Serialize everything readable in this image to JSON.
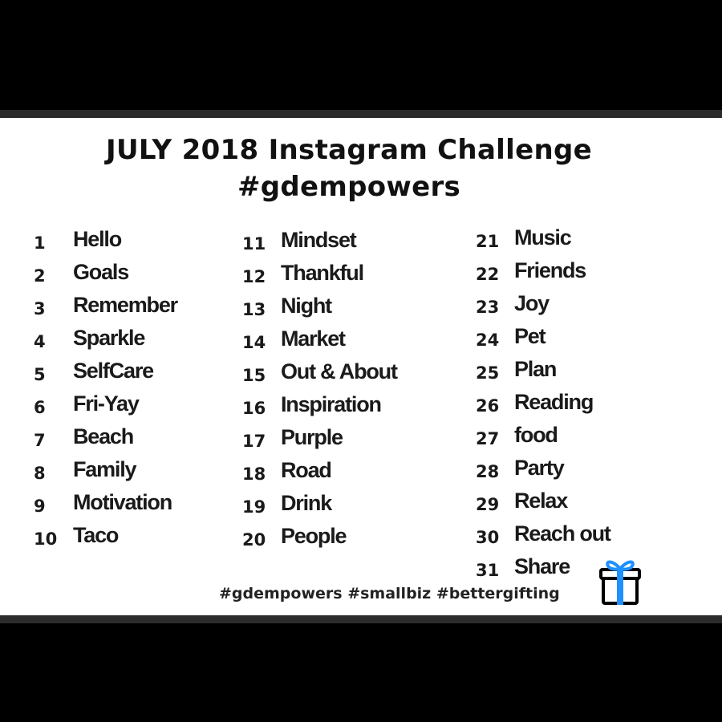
{
  "title_line_1": "JULY 2018 Instagram Challenge",
  "title_line_2": "#gdempowers",
  "columns": [
    [
      {
        "num": "1",
        "word": "Hello"
      },
      {
        "num": "2",
        "word": "Goals"
      },
      {
        "num": "3",
        "word": "Remember"
      },
      {
        "num": "4",
        "word": "Sparkle"
      },
      {
        "num": "5",
        "word": "SelfCare"
      },
      {
        "num": "6",
        "word": "Fri-Yay"
      },
      {
        "num": "7",
        "word": "Beach"
      },
      {
        "num": "8",
        "word": "Family"
      },
      {
        "num": "9",
        "word": "Motivation"
      },
      {
        "num": "10",
        "word": "Taco"
      }
    ],
    [
      {
        "num": "11",
        "word": "Mindset"
      },
      {
        "num": "12",
        "word": "Thankful"
      },
      {
        "num": "13",
        "word": "Night"
      },
      {
        "num": "14",
        "word": "Market"
      },
      {
        "num": "15",
        "word": "Out & About"
      },
      {
        "num": "16",
        "word": "Inspiration"
      },
      {
        "num": "17",
        "word": "Purple"
      },
      {
        "num": "18",
        "word": "Road"
      },
      {
        "num": "19",
        "word": "Drink"
      },
      {
        "num": "20",
        "word": "People"
      }
    ],
    [
      {
        "num": "21",
        "word": "Music"
      },
      {
        "num": "22",
        "word": "Friends"
      },
      {
        "num": "23",
        "word": "Joy"
      },
      {
        "num": "24",
        "word": "Pet"
      },
      {
        "num": "25",
        "word": "Plan"
      },
      {
        "num": "26",
        "word": "Reading"
      },
      {
        "num": "27",
        "word": "food"
      },
      {
        "num": "28",
        "word": "Party"
      },
      {
        "num": "29",
        "word": "Relax"
      },
      {
        "num": "30",
        "word": "Reach out"
      },
      {
        "num": "31",
        "word": "Share"
      }
    ]
  ],
  "hashtags": "#gdempowers #smallbiz #bettergifting",
  "gift_icon": "gift-icon",
  "colors": {
    "background": "#000000",
    "card": "#ffffff",
    "band": "#2b2b2b",
    "text": "#1a1a1a",
    "gift_ribbon": "#1e90ff"
  }
}
